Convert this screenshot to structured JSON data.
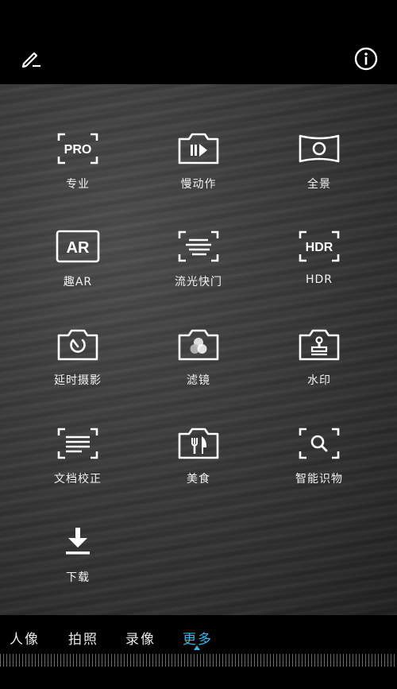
{
  "header": {
    "edit_icon": "pencil-icon",
    "info_icon": "info-icon"
  },
  "modes": [
    {
      "label": "专业",
      "icon": "pro-icon",
      "badge": "PRO"
    },
    {
      "label": "慢动作",
      "icon": "slow-motion-icon"
    },
    {
      "label": "全景",
      "icon": "panorama-icon"
    },
    {
      "label": "趣AR",
      "icon": "ar-icon",
      "badge": "AR"
    },
    {
      "label": "流光快门",
      "icon": "light-painting-icon"
    },
    {
      "label": "HDR",
      "icon": "hdr-icon",
      "badge": "HDR"
    },
    {
      "label": "延时摄影",
      "icon": "time-lapse-icon"
    },
    {
      "label": "滤镜",
      "icon": "filter-icon"
    },
    {
      "label": "水印",
      "icon": "watermark-icon"
    },
    {
      "label": "文档校正",
      "icon": "document-correction-icon"
    },
    {
      "label": "美食",
      "icon": "food-icon"
    },
    {
      "label": "智能识物",
      "icon": "smart-recognition-icon"
    },
    {
      "label": "下载",
      "icon": "download-icon"
    }
  ],
  "bottom_tabs": [
    {
      "label": "人像",
      "active": false
    },
    {
      "label": "拍照",
      "active": false
    },
    {
      "label": "录像",
      "active": false
    },
    {
      "label": "更多",
      "active": true
    }
  ],
  "colors": {
    "accent": "#35b8e6",
    "background": "#000000",
    "icon": "#ffffff"
  }
}
